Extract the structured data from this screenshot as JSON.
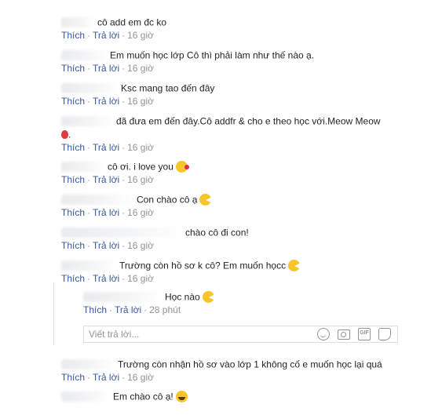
{
  "actions": {
    "like": "Thích",
    "reply": "Trả lời",
    "sep": "·"
  },
  "comments": [
    {
      "text": "cô add em đc ko",
      "time": "16 giờ"
    },
    {
      "text": "Em muốn học lớp Cô thì phải làm như thế nào ạ.",
      "time": "16 giờ"
    },
    {
      "text": "Ksc mang tao đến đây",
      "time": "16 giờ"
    },
    {
      "text": "đã đưa em đến đây.Cô addfr & cho e theo học với.Meow Meow",
      "time": "16 giờ"
    },
    {
      "text": "cô ơi. i love you",
      "time": "16 giờ",
      "emoji": "kiss-emoji"
    },
    {
      "text": "Con chào cô ạ",
      "time": "16 giờ",
      "emoji": "pacman-emoji"
    },
    {
      "text": "chào cô đi con!",
      "time": "16 giờ"
    },
    {
      "text": "Trường còn hồ sơ k cô? Em muốn họcc",
      "time": "16 giờ",
      "emoji": "pacman-emoji"
    },
    {
      "text": "Trường còn nhận hồ sơ vào lớp 1 không cố e muốn học lại quá",
      "time": "16 giờ"
    },
    {
      "text": "Em chào cô ạ!",
      "emoji": "grin-emoji"
    }
  ],
  "reply": {
    "text": "Học nào",
    "time": "28 phút",
    "emoji": "pacman-emoji"
  },
  "reply_box": {
    "placeholder": "Viết trả lời..."
  },
  "icons": [
    "balloon-icon",
    "emoji-icon",
    "camera-icon",
    "gif-icon",
    "sticker-icon"
  ],
  "colors": {
    "link": "#365899",
    "meta": "#90949c",
    "text": "#1d2129",
    "border": "#dddfe2",
    "emoji": "#f7c42a"
  }
}
